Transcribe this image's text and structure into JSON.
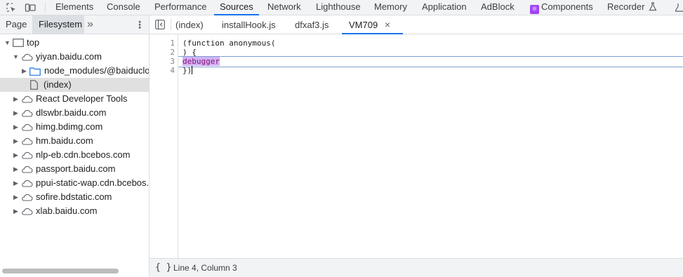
{
  "toolbar": {
    "icons": [
      "inspect-element-icon",
      "device-toolbar-icon"
    ],
    "tabs": [
      {
        "label": "Elements"
      },
      {
        "label": "Console"
      },
      {
        "label": "Performance"
      },
      {
        "label": "Sources",
        "active": true
      },
      {
        "label": "Network"
      },
      {
        "label": "Lighthouse"
      },
      {
        "label": "Memory"
      },
      {
        "label": "Application"
      },
      {
        "label": "AdBlock"
      },
      {
        "label": "Components"
      },
      {
        "label": "Recorder"
      }
    ],
    "accent_color": "#1a73e8"
  },
  "navigator": {
    "tabs": [
      {
        "label": "Page"
      },
      {
        "label": "Filesystem",
        "active": true
      }
    ],
    "more": "»",
    "tree": [
      {
        "label": "top"
      },
      {
        "label": "yiyan.baidu.com"
      },
      {
        "label": "node_modules/@baiducloud"
      },
      {
        "label": "(index)",
        "selected": true
      },
      {
        "label": "React Developer Tools"
      },
      {
        "label": "dlswbr.baidu.com"
      },
      {
        "label": "himg.bdimg.com"
      },
      {
        "label": "hm.baidu.com"
      },
      {
        "label": "nlp-eb.cdn.bcebos.com"
      },
      {
        "label": "passport.baidu.com"
      },
      {
        "label": "ppui-static-wap.cdn.bcebos.com"
      },
      {
        "label": "sofire.bdstatic.com"
      },
      {
        "label": "xlab.baidu.com"
      }
    ]
  },
  "editor": {
    "tabs": [
      {
        "label": "(index)"
      },
      {
        "label": "installHook.js"
      },
      {
        "label": "dfxaf3.js"
      },
      {
        "label": "VM709",
        "active": true,
        "close": "×"
      }
    ],
    "line_numbers": [
      "1",
      "2",
      "3",
      "4"
    ],
    "lines": {
      "l1": "(function anonymous(",
      "l2": ") {",
      "l3": "debugger",
      "l4": "})"
    }
  },
  "status": {
    "brace_icon": "{ }",
    "position": "Line 4, Column 3"
  }
}
